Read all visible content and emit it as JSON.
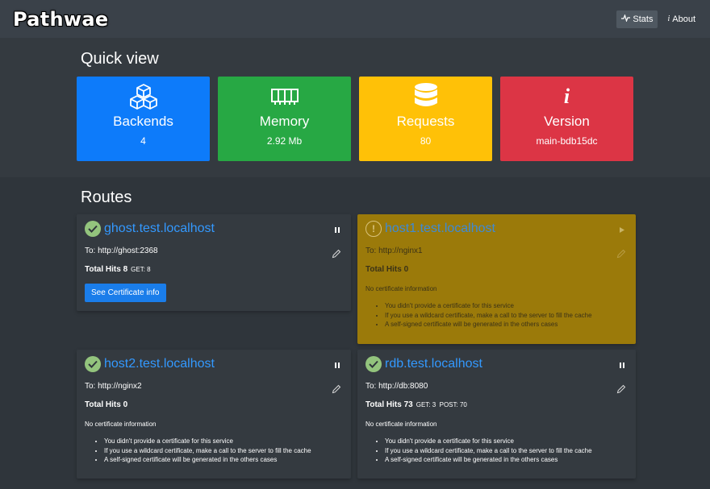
{
  "brand": "Pathwae",
  "nav": {
    "stats": "Stats",
    "about": "About"
  },
  "quick_view": {
    "title": "Quick view",
    "cards": [
      {
        "label": "Backends",
        "value": "4",
        "color": "#0d7bfa",
        "icon": "cubes-icon"
      },
      {
        "label": "Memory",
        "value": "2.92 Mb",
        "color": "#27a844",
        "icon": "memory-icon"
      },
      {
        "label": "Requests",
        "value": "80",
        "color": "#ffc107",
        "icon": "database-icon"
      },
      {
        "label": "Version",
        "value": "main-bdb15dc",
        "color": "#dc3545",
        "icon": "info-icon"
      }
    ]
  },
  "routes": {
    "title": "Routes",
    "items": [
      {
        "host": "ghost.test.localhost",
        "to": "To: http://ghost:2368",
        "total_hits": "Total Hits 8",
        "methods": "GET: 8",
        "status": "ok",
        "button": "See Certificate info"
      },
      {
        "host": "host1.test.localhost",
        "to": "To: http://nginx1",
        "total_hits": "Total Hits 0",
        "methods": "",
        "status": "warning",
        "no_cert": "No certificate information",
        "notes": [
          "You didn't provide a certificate for this service",
          "If you use a wildcard certificate, make a call to the server to fill the cache",
          "A self-signed certificate will be generated in the others cases"
        ]
      },
      {
        "host": "host2.test.localhost",
        "to": "To: http://nginx2",
        "total_hits": "Total Hits 0",
        "methods": "",
        "status": "ok",
        "no_cert": "No certificate information",
        "notes": [
          "You didn't provide a certificate for this service",
          "If you use a wildcard certificate, make a call to the server to fill the cache",
          "A self-signed certificate will be generated in the others cases"
        ]
      },
      {
        "host": "rdb.test.localhost",
        "to": "To: http://db:8080",
        "total_hits": "Total Hits 73",
        "methods": "GET: 3  POST: 70",
        "status": "ok",
        "no_cert": "No certificate information",
        "notes": [
          "You didn't provide a certificate for this service",
          "If you use a wildcard certificate, make a call to the server to fill the cache",
          "A self-signed certificate will be generated in the others cases"
        ]
      }
    ]
  }
}
